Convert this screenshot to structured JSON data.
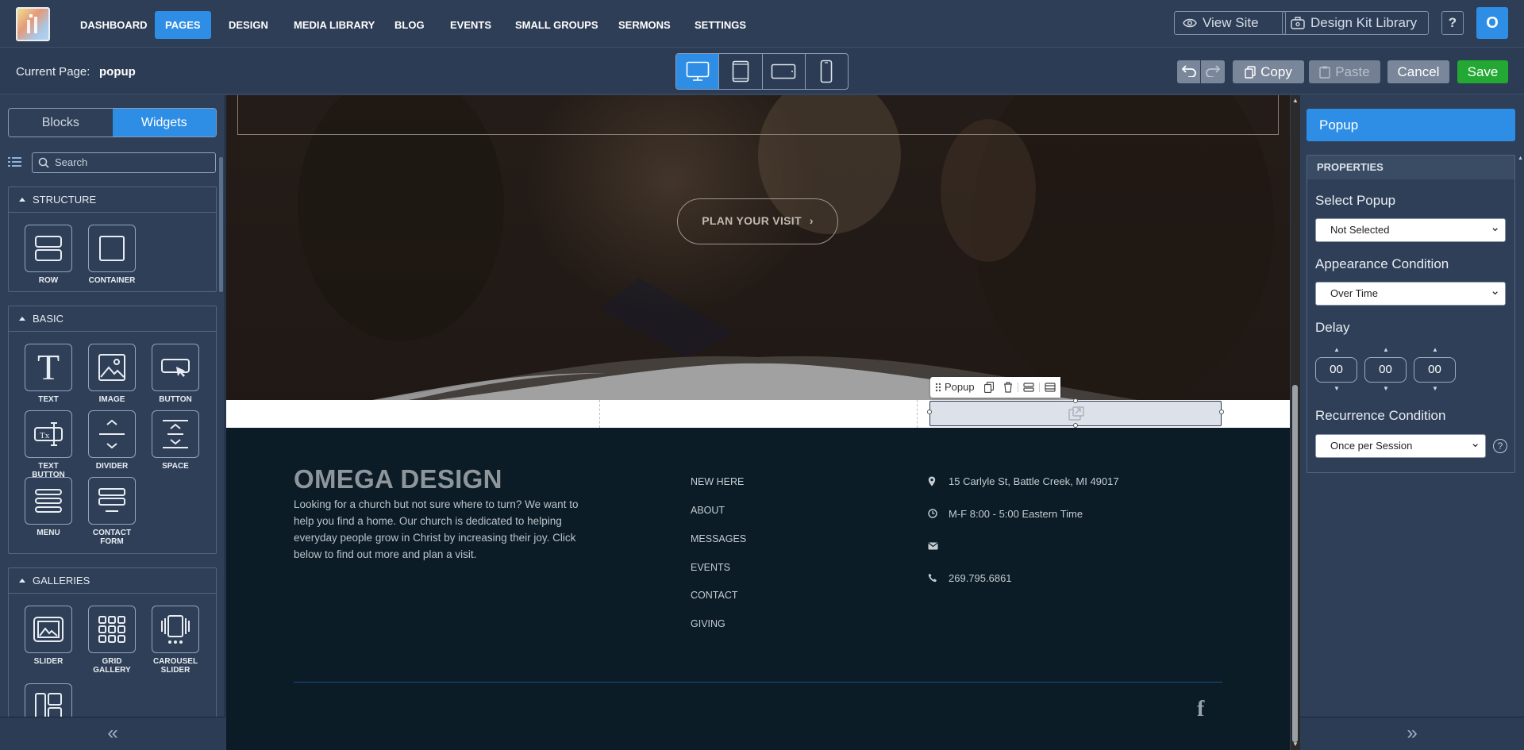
{
  "nav": {
    "items": [
      {
        "label": "DASHBOARD",
        "active": false
      },
      {
        "label": "PAGES",
        "active": true
      },
      {
        "label": "DESIGN",
        "active": false
      },
      {
        "label": "MEDIA LIBRARY",
        "active": false
      },
      {
        "label": "BLOG",
        "active": false
      },
      {
        "label": "EVENTS",
        "active": false
      },
      {
        "label": "SMALL GROUPS",
        "active": false
      },
      {
        "label": "SERMONS",
        "active": false
      },
      {
        "label": "SETTINGS",
        "active": false
      }
    ],
    "view_site": "View Site",
    "design_kit": "Design Kit Library",
    "help": "?",
    "avatar_initial": "O"
  },
  "subbar": {
    "current_page_label": "Current Page:",
    "current_page_value": "popup",
    "devices": [
      "desktop-icon",
      "tablet-icon",
      "tablet-landscape-icon",
      "mobile-icon"
    ],
    "copy": "Copy",
    "paste": "Paste",
    "cancel": "Cancel",
    "save": "Save"
  },
  "left": {
    "tabs": [
      "Blocks",
      "Widgets"
    ],
    "active_tab": "Widgets",
    "search_placeholder": "Search",
    "sections": {
      "structure": {
        "title": "STRUCTURE",
        "widgets": [
          "ROW",
          "CONTAINER"
        ]
      },
      "basic": {
        "title": "BASIC",
        "widgets": [
          "TEXT",
          "IMAGE",
          "BUTTON",
          "TEXT BUTTON",
          "DIVIDER",
          "SPACE",
          "MENU",
          "CONTACT FORM"
        ]
      },
      "galleries": {
        "title": "GALLERIES",
        "widgets": [
          "SLIDER",
          "GRID GALLERY",
          "CAROUSEL SLIDER"
        ]
      }
    },
    "collapse": "«"
  },
  "canvas": {
    "hero_button": "PLAN YOUR VISIT",
    "popup_toolbar_label": "Popup",
    "footer": {
      "brand": "OMEGA DESIGN",
      "description": "Looking for a church but not sure where to turn? We want to help you find a home. Our church is dedicated to helping everyday people grow in Christ by increasing their joy.  Click below to find out more and plan a visit.",
      "links": [
        "NEW HERE",
        "ABOUT",
        "MESSAGES",
        "EVENTS",
        "CONTACT",
        "GIVING"
      ],
      "address": "15 Carlyle St, Battle Creek, MI 49017",
      "hours": "M-F 8:00 - 5:00 Eastern Time",
      "phone": "269.795.6861",
      "social": "f"
    }
  },
  "right": {
    "title": "Popup",
    "properties_header": "PROPERTIES",
    "select_popup_label": "Select Popup",
    "select_popup_value": "Not Selected",
    "appearance_label": "Appearance Condition",
    "appearance_value": "Over Time",
    "delay_label": "Delay",
    "delay_values": [
      "00",
      "00",
      "00"
    ],
    "recurrence_label": "Recurrence Condition",
    "recurrence_value": "Once per Session",
    "recurrence_help": "?",
    "expand": "»"
  },
  "colors": {
    "accent": "#2e8ee6",
    "save": "#22a833",
    "panel": "#2f3f57",
    "footer": "#0b1c27"
  }
}
